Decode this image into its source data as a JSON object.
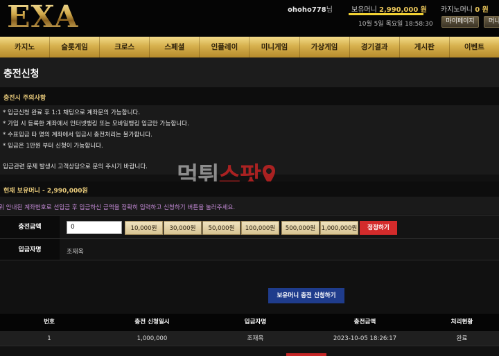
{
  "header": {
    "logo": "EXA",
    "username": "ohoho778",
    "username_suffix": "님",
    "balance_label": "보유머니",
    "balance_value": "2,990,000 원",
    "casino_label": "카지노머니",
    "casino_value": "0 원",
    "datetime": "10월 5일 목요일 18:58:30",
    "mypage_label": "마이페이지",
    "second_btn_label": "머니"
  },
  "nav": {
    "items": [
      "카지노",
      "슬롯게임",
      "크로스",
      "스페셜",
      "인플레이",
      "미니게임",
      "가상게임",
      "경기결과",
      "게시판",
      "이벤트"
    ]
  },
  "page": {
    "title": "충전신청",
    "notice_title": "충전시 주의사항",
    "notices": [
      "* 입금신청 완료 후 1:1 채팅으로 계좌문의 가능합니다.",
      "* 가입 시 등록한 계좌에서 인터넷뱅킹 또는 모바일뱅킹 입금만 가능합니다.",
      "* 수표입금 타 명의 계좌에서 입금시 충전처리는 불가합니다.",
      "* 입금은 1만원 부터 신청이 가능합니다."
    ],
    "notice_contact": "입금관련 문제 발생시 고객상담으로 문의 주시기 바랍니다.",
    "watermark_white": "먹튀",
    "watermark_red": "스팟",
    "current_balance": "현재 보유머니 - 2,990,000원",
    "guide": "위 안내된 계좌번호로 선입금 후 입금하신 금액을 정확히 입력하고 신청하기 버튼을 눌러주세요."
  },
  "form": {
    "amount_label": "충전금액",
    "amount_value": "0",
    "chips": [
      "10,000원",
      "30,000원",
      "50,000원",
      "100,000원",
      "500,000원",
      "1,000,000원"
    ],
    "reset_label": "정정하기",
    "depositor_label": "입금자명",
    "depositor_value": "조재옥",
    "submit_label": "보유머니 충전 신청하기"
  },
  "table": {
    "headers": [
      "번호",
      "충전 신청일시",
      "입금자명",
      "충전금액",
      "처리현황"
    ],
    "rows": [
      [
        "1",
        "1,000,000",
        "조재옥",
        "2023-10-05 18:26:17",
        "완료"
      ]
    ]
  }
}
